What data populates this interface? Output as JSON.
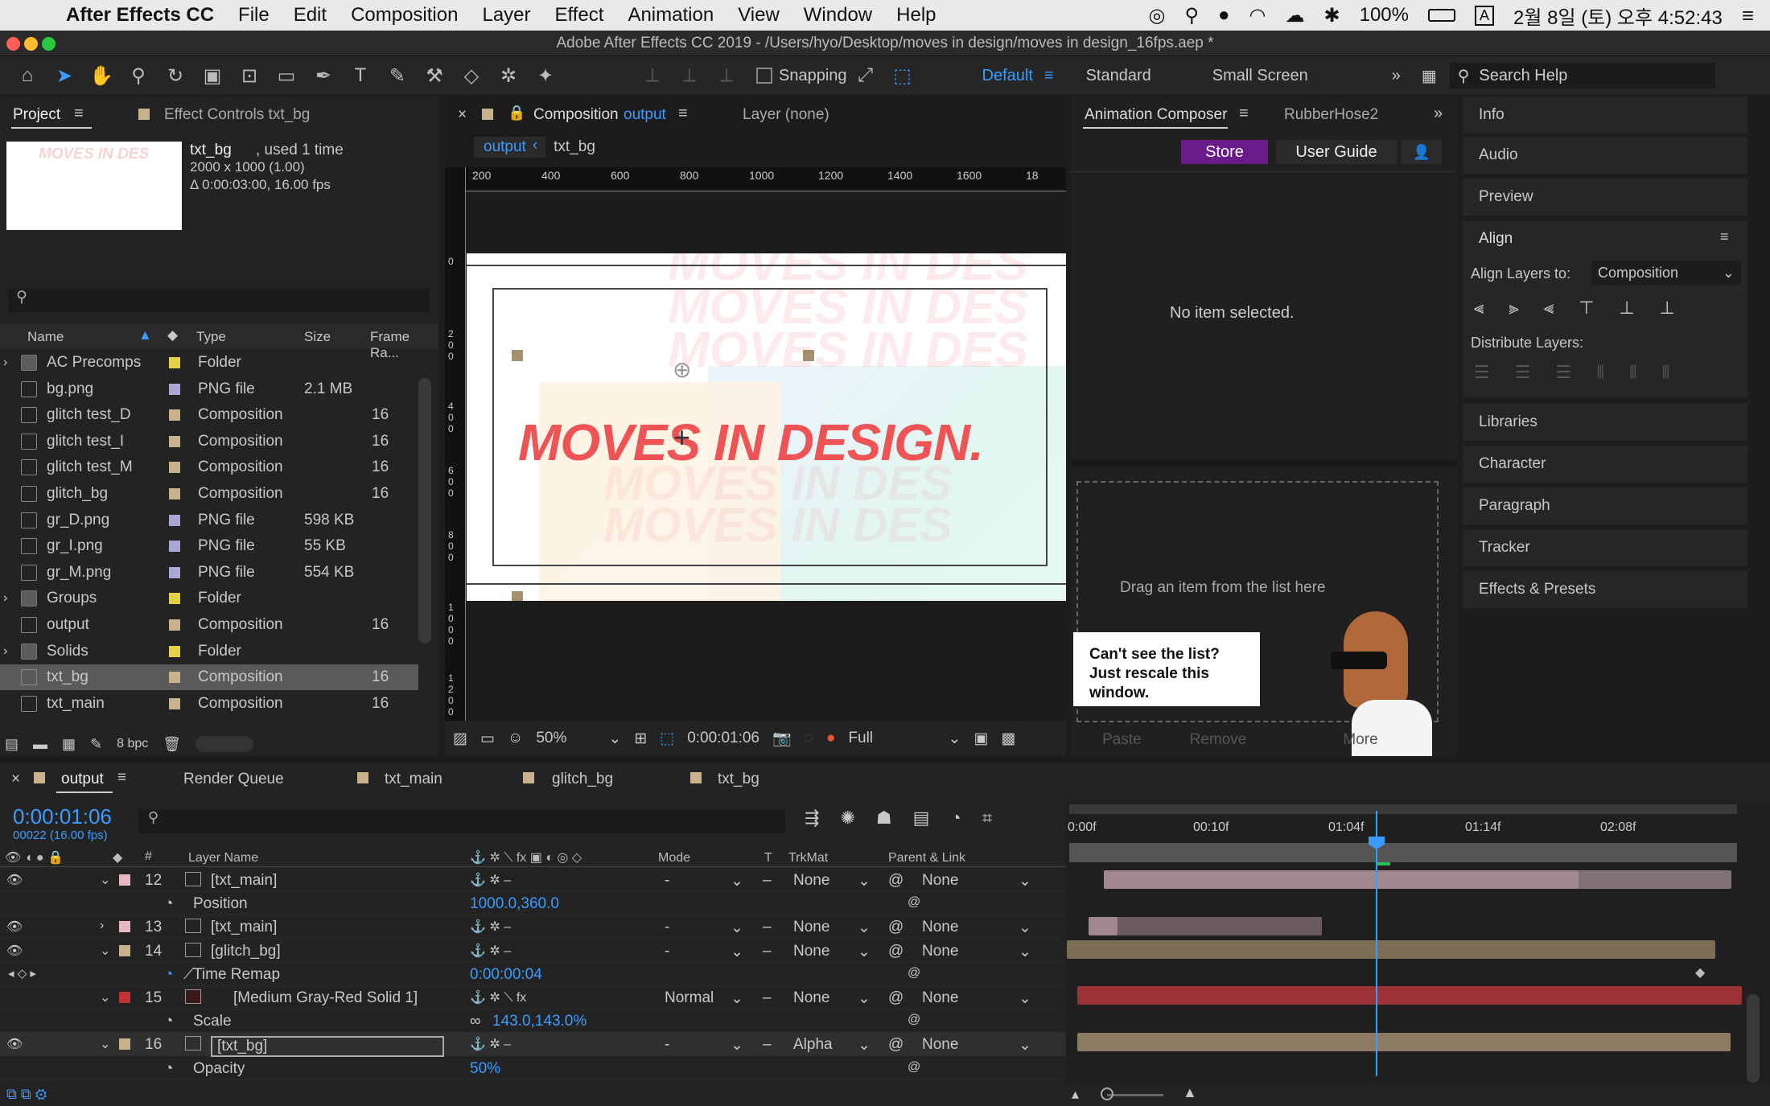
{
  "menubar": {
    "app": "After Effects CC",
    "items": [
      "File",
      "Edit",
      "Composition",
      "Layer",
      "Effect",
      "Animation",
      "View",
      "Window",
      "Help"
    ],
    "battery": "100%",
    "input": "A",
    "clock": "2월 8일 (토) 오후 4:52:43"
  },
  "window_title": "Adobe After Effects CC 2019 - /Users/hyo/Desktop/moves in design/moves in design_16fps.aep *",
  "toolbar": {
    "snapping": "Snapping",
    "workspaces": [
      "Default",
      "Standard",
      "Small Screen"
    ],
    "search_placeholder": "Search Help"
  },
  "project": {
    "tab": "Project",
    "tab2": "Effect Controls txt_bg",
    "selected_name": "txt_bg",
    "selected_used": ", used 1 time",
    "selected_dims": "2000 x 1000 (1.00)",
    "selected_duration": "Δ 0:00:03:00, 16.00 fps",
    "columns": [
      "Name",
      "Type",
      "Size",
      "Frame Ra..."
    ],
    "bpc": "8 bpc",
    "items": [
      {
        "name": "AC Precomps",
        "type": "Folder",
        "size": "",
        "fps": "",
        "color": "#e3d14a"
      },
      {
        "name": "bg.png",
        "type": "PNG file",
        "size": "2.1 MB",
        "fps": "",
        "color": "#a9a7d6"
      },
      {
        "name": "glitch test_D",
        "type": "Composition",
        "size": "",
        "fps": "16",
        "color": "#c8b28e"
      },
      {
        "name": "glitch test_I",
        "type": "Composition",
        "size": "",
        "fps": "16",
        "color": "#c8b28e"
      },
      {
        "name": "glitch test_M",
        "type": "Composition",
        "size": "",
        "fps": "16",
        "color": "#c8b28e"
      },
      {
        "name": "glitch_bg",
        "type": "Composition",
        "size": "",
        "fps": "16",
        "color": "#c8b28e"
      },
      {
        "name": "gr_D.png",
        "type": "PNG file",
        "size": "598 KB",
        "fps": "",
        "color": "#a9a7d6"
      },
      {
        "name": "gr_I.png",
        "type": "PNG file",
        "size": "55 KB",
        "fps": "",
        "color": "#a9a7d6"
      },
      {
        "name": "gr_M.png",
        "type": "PNG file",
        "size": "554 KB",
        "fps": "",
        "color": "#a9a7d6"
      },
      {
        "name": "Groups",
        "type": "Folder",
        "size": "",
        "fps": "",
        "color": "#e3d14a"
      },
      {
        "name": "output",
        "type": "Composition",
        "size": "",
        "fps": "16",
        "color": "#c8b28e"
      },
      {
        "name": "Solids",
        "type": "Folder",
        "size": "",
        "fps": "",
        "color": "#e3d14a"
      },
      {
        "name": "txt_bg",
        "type": "Composition",
        "size": "",
        "fps": "16",
        "color": "#c8b28e"
      },
      {
        "name": "txt_main",
        "type": "Composition",
        "size": "",
        "fps": "16",
        "color": "#c8b28e"
      }
    ]
  },
  "comp": {
    "tab": "Composition",
    "tab_name": "output",
    "layer_tab": "Layer (none)",
    "breadcrumbs": [
      "output",
      "txt_bg"
    ],
    "ruler": [
      "200",
      "400",
      "600",
      "800",
      "1000",
      "1200",
      "1400",
      "1600",
      "18"
    ],
    "vruler": [
      "0",
      "200",
      "400",
      "600",
      "800",
      "1000",
      "1200"
    ],
    "headline": "MOVES IN DESIGN.",
    "ghost": "MOVES IN DES",
    "zoom": "50%",
    "time": "0:00:01:06",
    "resolution": "Full"
  },
  "composer": {
    "tab": "Animation Composer",
    "tab2": "RubberHose2",
    "store": "Store",
    "guide": "User Guide",
    "empty": "No item selected.",
    "drag": "Drag an item from the list here",
    "tip": "Can't see the list? Just rescale this window.",
    "actions": [
      "Paste",
      "Remove",
      "More"
    ]
  },
  "right_panels": {
    "info": "Info",
    "audio": "Audio",
    "preview": "Preview",
    "align": "Align",
    "align_to_label": "Align Layers to:",
    "align_to": "Composition",
    "distribute": "Distribute Layers:",
    "libraries": "Libraries",
    "character": "Character",
    "paragraph": "Paragraph",
    "tracker": "Tracker",
    "effects": "Effects & Presets"
  },
  "timeline": {
    "tabs": [
      "output",
      "Render Queue",
      "txt_main",
      "glitch_bg",
      "txt_bg"
    ],
    "timecode": "0:00:01:06",
    "frames": "00022 (16.00 fps)",
    "cols": {
      "layer": "Layer Name",
      "mode": "Mode",
      "t": "T",
      "trkmat": "TrkMat",
      "parent": "Parent & Link"
    },
    "ruler": [
      "0:00f",
      "00:10f",
      "01:04f",
      "01:14f",
      "02:08f"
    ],
    "rows": [
      {
        "num": "12",
        "name": "[txt_main]",
        "mode": "-",
        "trk": "None",
        "parent": "None",
        "color": "#e7b7c2"
      },
      {
        "prop": "Position",
        "value": "1000.0,360.0"
      },
      {
        "num": "13",
        "name": "[txt_main]",
        "mode": "-",
        "trk": "None",
        "parent": "None",
        "color": "#e7b7c2"
      },
      {
        "num": "14",
        "name": "[glitch_bg]",
        "mode": "-",
        "trk": "None",
        "parent": "None",
        "color": "#c8b28e"
      },
      {
        "prop": "Time Remap",
        "value": "0:00:00:04"
      },
      {
        "num": "15",
        "name": "[Medium Gray-Red Solid 1]",
        "mode": "Normal",
        "trk": "None",
        "parent": "None",
        "color": "#c13333"
      },
      {
        "prop": "Scale",
        "value": "143.0,143.0%"
      },
      {
        "num": "16",
        "name": "[txt_bg]",
        "mode": "-",
        "trk": "Alpha",
        "parent": "None",
        "color": "#c8b28e"
      },
      {
        "prop": "Opacity",
        "value": "50%"
      }
    ]
  },
  "colors": {
    "accent": "#3b9cff",
    "store": "#6a1b8a",
    "red_layer": "#9a3236",
    "pink_layer": "#a08790",
    "tan_layer": "#7c6d57"
  }
}
